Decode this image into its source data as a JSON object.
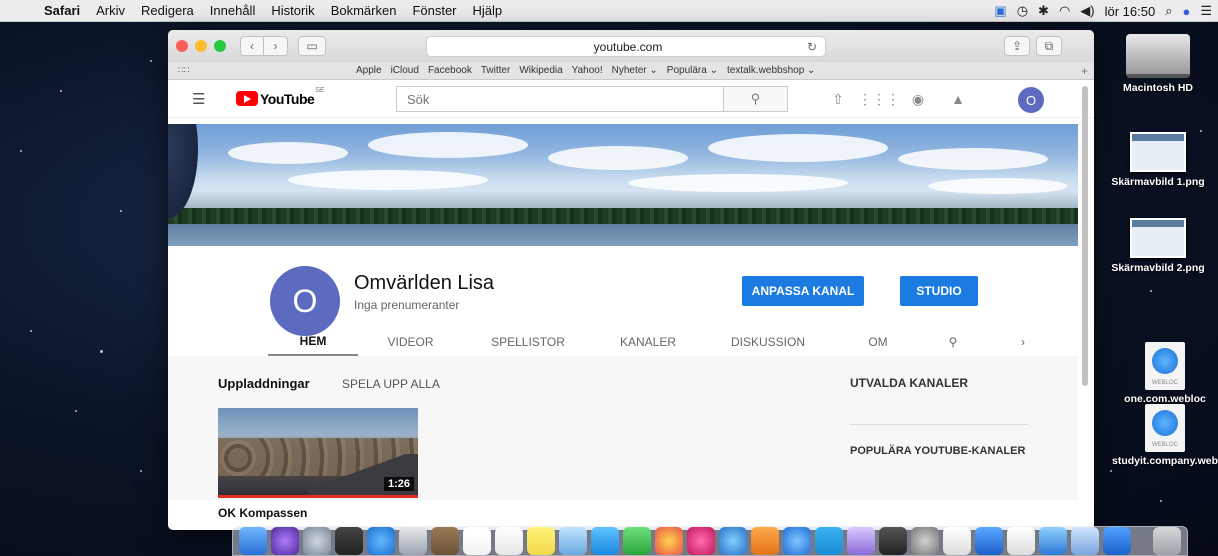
{
  "menubar": {
    "app": "Safari",
    "items": [
      "Arkiv",
      "Redigera",
      "Innehåll",
      "Historik",
      "Bokmärken",
      "Fönster",
      "Hjälp"
    ],
    "clock": "lör 16:50"
  },
  "browser": {
    "url": "youtube.com",
    "favorites": [
      "Apple",
      "iCloud",
      "Facebook",
      "Twitter",
      "Wikipedia",
      "Yahoo!",
      "Nyheter ⌄",
      "Populära ⌄",
      "textalk.webbshop ⌄"
    ]
  },
  "youtube": {
    "logo_text": "YouTube",
    "region": "SE",
    "search_placeholder": "Sök",
    "user_initial": "O",
    "channel": {
      "initial": "O",
      "name": "Omvärlden Lisa",
      "subscribers": "Inga prenumeranter",
      "customize_label": "ANPASSA KANAL",
      "studio_label": "STUDIO"
    },
    "tabs": [
      "HEM",
      "VIDEOR",
      "SPELLISTOR",
      "KANALER",
      "DISKUSSION",
      "OM"
    ],
    "uploads": {
      "title": "Uppladdningar",
      "play_all": "SPELA UPP ALLA",
      "video_title": "OK Kompassen",
      "duration": "1:26"
    },
    "sidebar": {
      "featured": "UTVALDA KANALER",
      "popular": "POPULÄRA YOUTUBE-KANALER"
    }
  },
  "desktop": {
    "icons": [
      {
        "label": "Macintosh HD"
      },
      {
        "label": "Skärmavbild 1.png"
      },
      {
        "label": "Skärmavbild 2.png"
      },
      {
        "label": "one.com.webloc"
      },
      {
        "label": "studyit.company.webloc"
      }
    ],
    "webloc_tag": "WEBLOC"
  },
  "colors": {
    "youtube_red": "#ff0000",
    "button_blue": "#1c7be0",
    "avatar_purple": "#5c6bc0"
  }
}
